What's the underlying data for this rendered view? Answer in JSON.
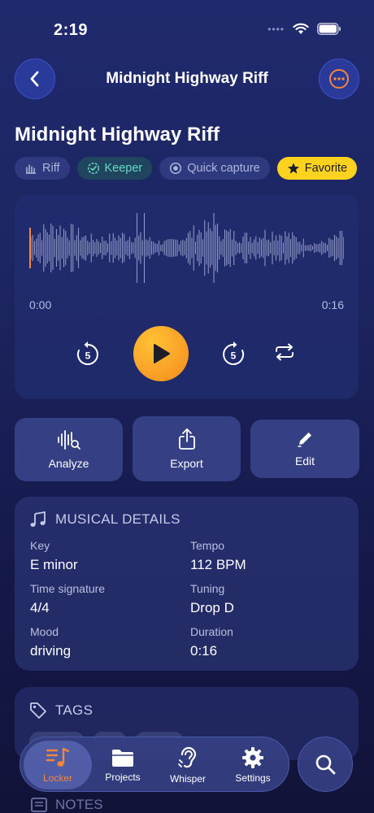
{
  "status": {
    "time": "2:19",
    "signal": "••••"
  },
  "nav": {
    "title": "Midnight Highway Riff"
  },
  "recording": {
    "title": "Midnight Highway Riff",
    "chips": [
      {
        "label": "Riff",
        "icon": "guitar-icon"
      },
      {
        "label": "Keeper",
        "icon": "check-badge-icon"
      },
      {
        "label": "Quick capture",
        "icon": "record-icon"
      },
      {
        "label": "Favorite",
        "icon": "star-icon"
      }
    ]
  },
  "player": {
    "current_time": "0:00",
    "total_time": "0:16",
    "skip_back_seconds": "5",
    "skip_forward_seconds": "5",
    "accent": "#f5a623"
  },
  "actions": [
    {
      "label": "Analyze",
      "icon": "analyze-waveform-icon"
    },
    {
      "label": "Export",
      "icon": "share-icon"
    },
    {
      "label": "Edit",
      "icon": "pencil-icon"
    }
  ],
  "details": {
    "heading": "MUSICAL DETAILS",
    "items": [
      {
        "label": "Key",
        "value": "E minor"
      },
      {
        "label": "Tempo",
        "value": "112 BPM"
      },
      {
        "label": "Time signature",
        "value": "4/4"
      },
      {
        "label": "Tuning",
        "value": "Drop D"
      },
      {
        "label": "Mood",
        "value": "driving"
      },
      {
        "label": "Duration",
        "value": "0:16"
      }
    ]
  },
  "tags": {
    "heading": "TAGS"
  },
  "notes": {
    "heading": "NOTES"
  },
  "tabbar": {
    "tabs": [
      {
        "label": "Locker",
        "icon": "music-list-icon",
        "active": true
      },
      {
        "label": "Projects",
        "icon": "folder-icon",
        "active": false
      },
      {
        "label": "Whisper",
        "icon": "ear-icon",
        "active": false
      },
      {
        "label": "Settings",
        "icon": "gear-icon",
        "active": false
      }
    ]
  },
  "colors": {
    "accent": "#f5863c",
    "favorite": "#ffd21e",
    "keeper": "#67d9bf"
  }
}
